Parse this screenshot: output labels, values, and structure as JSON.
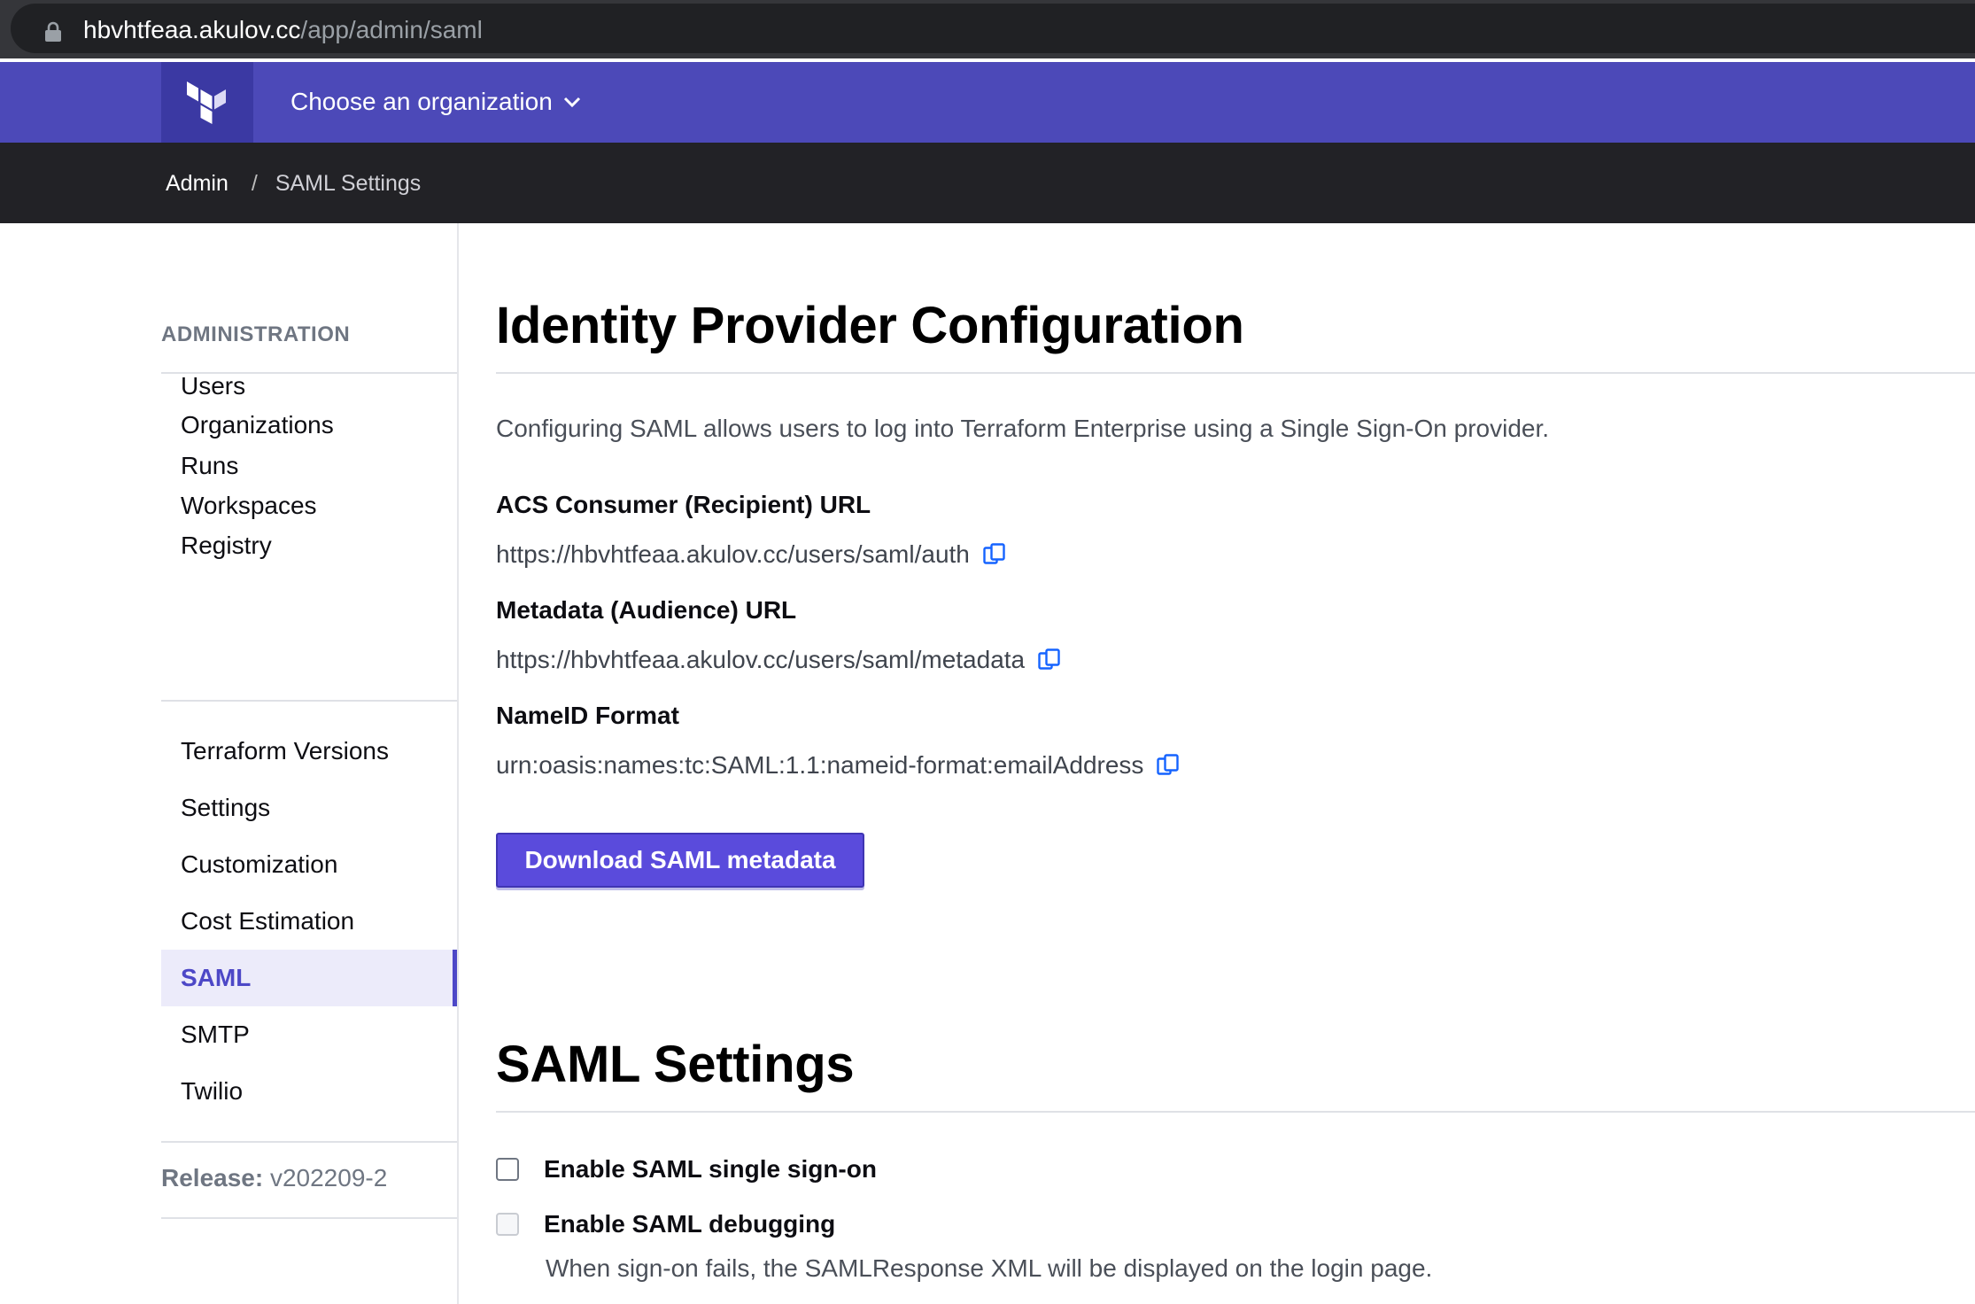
{
  "browser": {
    "url_host": "hbvhtfeaa.akulov.cc",
    "url_path": "/app/admin/saml"
  },
  "topnav": {
    "org_switcher_label": "Choose an organization"
  },
  "breadcrumb": {
    "items": [
      "Admin",
      "SAML Settings"
    ],
    "separator": "/"
  },
  "sidebar": {
    "heading": "ADMINISTRATION",
    "group1": [
      "Users",
      "Organizations",
      "Runs",
      "Workspaces",
      "Registry"
    ],
    "group2": [
      "Terraform Versions",
      "Settings",
      "Customization",
      "Cost Estimation",
      "SAML",
      "SMTP",
      "Twilio"
    ],
    "active_item": "SAML",
    "release_label": "Release:",
    "release_value": "v202209-2"
  },
  "main": {
    "idp_title": "Identity Provider Configuration",
    "intro": "Configuring SAML allows users to log into Terraform Enterprise using a Single Sign-On provider.",
    "fields": [
      {
        "label": "ACS Consumer (Recipient) URL",
        "value": "https://hbvhtfeaa.akulov.cc/users/saml/auth"
      },
      {
        "label": "Metadata (Audience) URL",
        "value": "https://hbvhtfeaa.akulov.cc/users/saml/metadata"
      },
      {
        "label": "NameID Format",
        "value": "urn:oasis:names:tc:SAML:1.1:nameid-format:emailAddress"
      }
    ],
    "download_button": "Download SAML metadata",
    "settings_title": "SAML Settings",
    "settings": [
      {
        "label": "Enable SAML single sign-on",
        "checked": false,
        "disabled": false
      },
      {
        "label": "Enable SAML debugging",
        "checked": false,
        "disabled": true
      }
    ],
    "debug_help": "When sign-on fails, the SAMLResponse XML will be displayed on the login page."
  },
  "colors": {
    "brand_purple": "#4c49b8",
    "logo_bg": "#3b39a3",
    "button_bg": "#5a4bdc",
    "active_text": "#4d48c7",
    "copy_icon": "#1563ff"
  },
  "icons": [
    "lock-icon",
    "terraform-logo-icon",
    "chevron-down-icon",
    "copy-icon"
  ]
}
